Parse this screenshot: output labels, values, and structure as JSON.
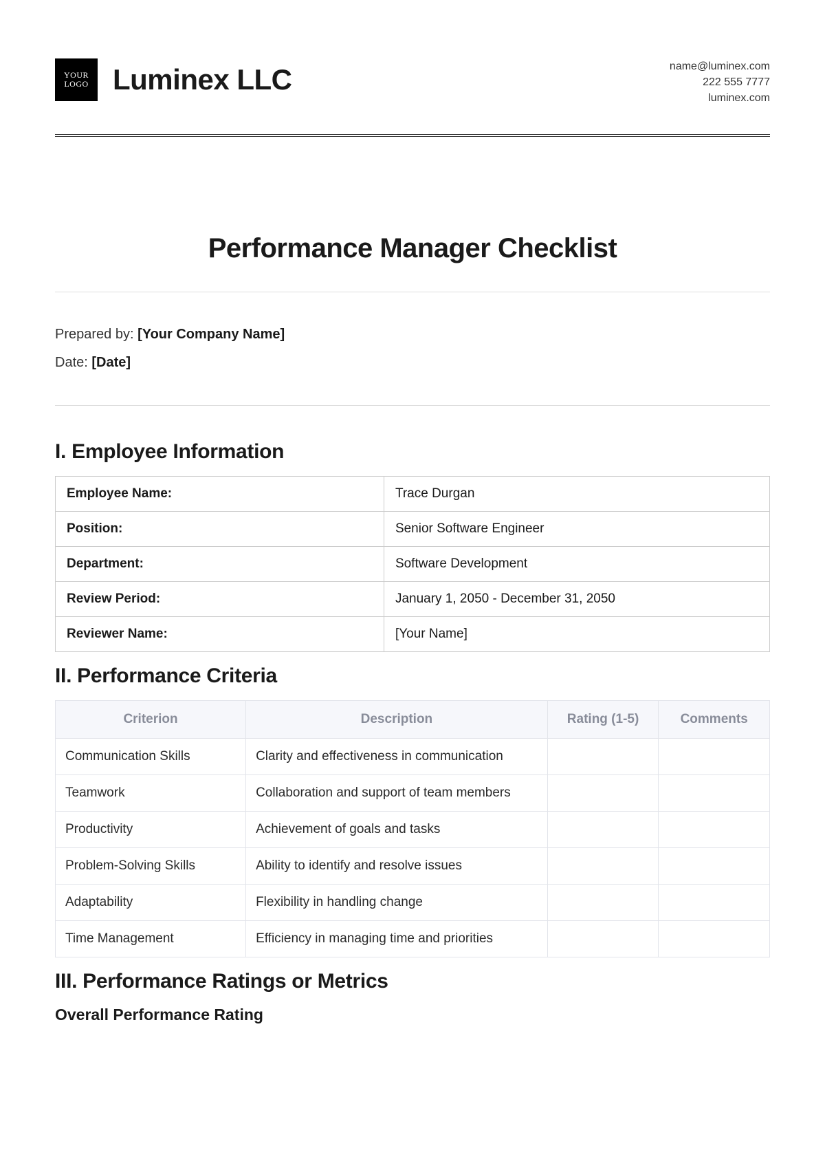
{
  "header": {
    "logo_line1": "YOUR",
    "logo_line2": "LOGO",
    "company_name": "Luminex LLC",
    "contact": {
      "email": "name@luminex.com",
      "phone": "222 555 7777",
      "website": "luminex.com"
    }
  },
  "title": "Performance Manager Checklist",
  "meta": {
    "prepared_by_label": "Prepared by: ",
    "prepared_by_value": "[Your Company Name]",
    "date_label": "Date: ",
    "date_value": "[Date]"
  },
  "sections": {
    "s1_heading": "I. Employee Information",
    "s2_heading": "II. Performance Criteria",
    "s3_heading": "III. Performance Ratings or Metrics",
    "s3_sub": "Overall Performance Rating"
  },
  "employee_info": {
    "rows": [
      {
        "label": "Employee Name:",
        "value": "Trace Durgan"
      },
      {
        "label": "Position:",
        "value": "Senior Software Engineer"
      },
      {
        "label": "Department:",
        "value": "Software Development"
      },
      {
        "label": "Review Period:",
        "value": "January 1, 2050 - December 31, 2050"
      },
      {
        "label": "Reviewer Name:",
        "value": "[Your Name]"
      }
    ]
  },
  "criteria": {
    "headers": {
      "criterion": "Criterion",
      "description": "Description",
      "rating": "Rating (1-5)",
      "comments": "Comments"
    },
    "rows": [
      {
        "criterion": "Communication Skills",
        "description": "Clarity and effectiveness in communication",
        "rating": "",
        "comments": ""
      },
      {
        "criterion": "Teamwork",
        "description": "Collaboration and support of team members",
        "rating": "",
        "comments": ""
      },
      {
        "criterion": "Productivity",
        "description": "Achievement of goals and tasks",
        "rating": "",
        "comments": ""
      },
      {
        "criterion": "Problem-Solving Skills",
        "description": "Ability to identify and resolve issues",
        "rating": "",
        "comments": ""
      },
      {
        "criterion": "Adaptability",
        "description": "Flexibility in handling change",
        "rating": "",
        "comments": ""
      },
      {
        "criterion": "Time Management",
        "description": "Efficiency in managing time and priorities",
        "rating": "",
        "comments": ""
      }
    ]
  }
}
